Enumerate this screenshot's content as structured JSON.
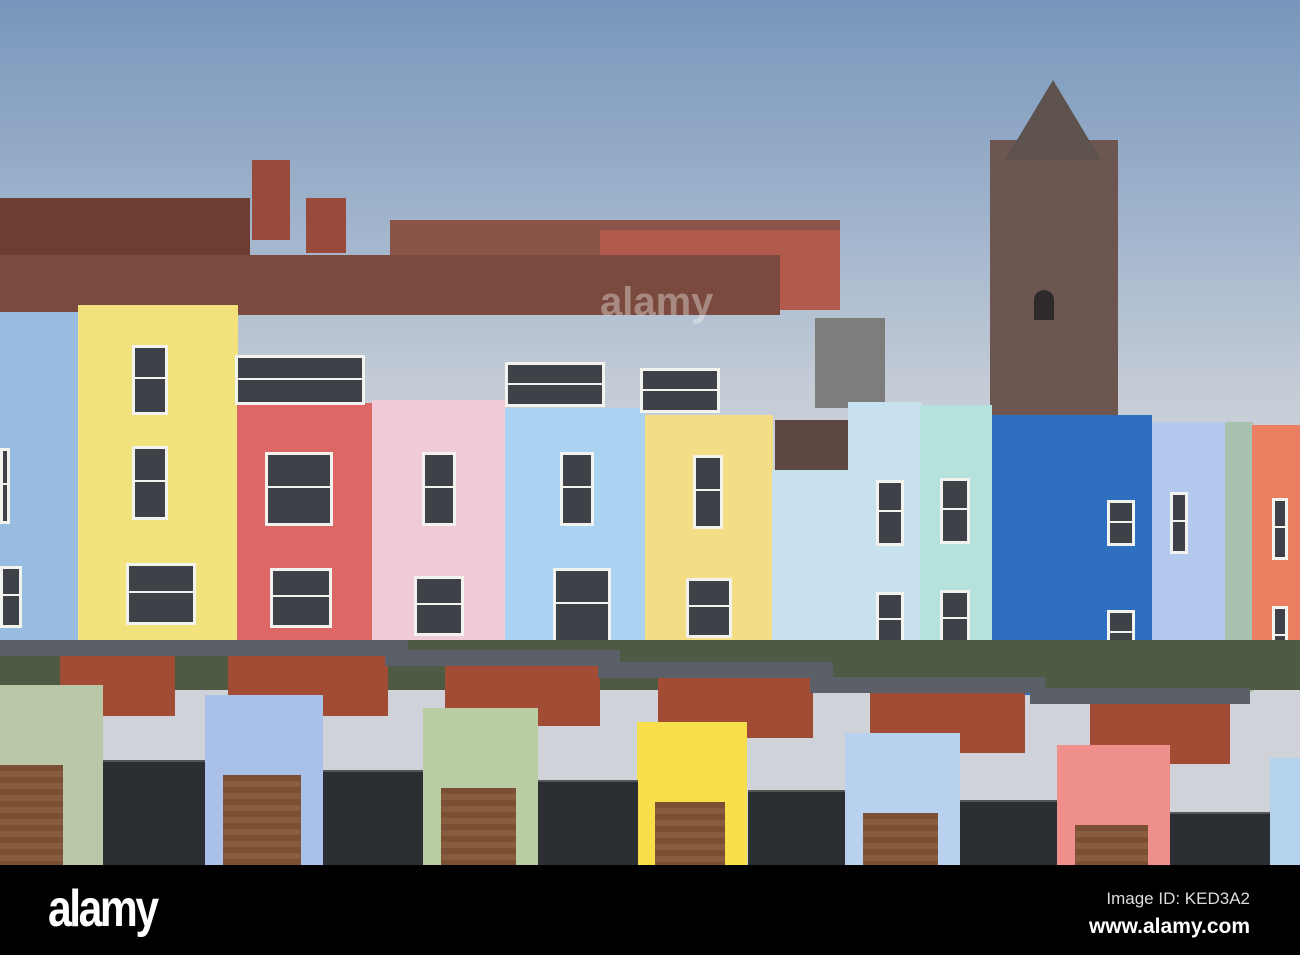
{
  "photo": {
    "subject": "Colourful terraced houses and modern homes with a church tower"
  },
  "watermark": {
    "logo": "alamy",
    "image_id": "Image ID: KED3A2",
    "url": "www.alamy.com"
  },
  "colors": {
    "sky": "#9fb3cc",
    "bar": "#000000"
  }
}
